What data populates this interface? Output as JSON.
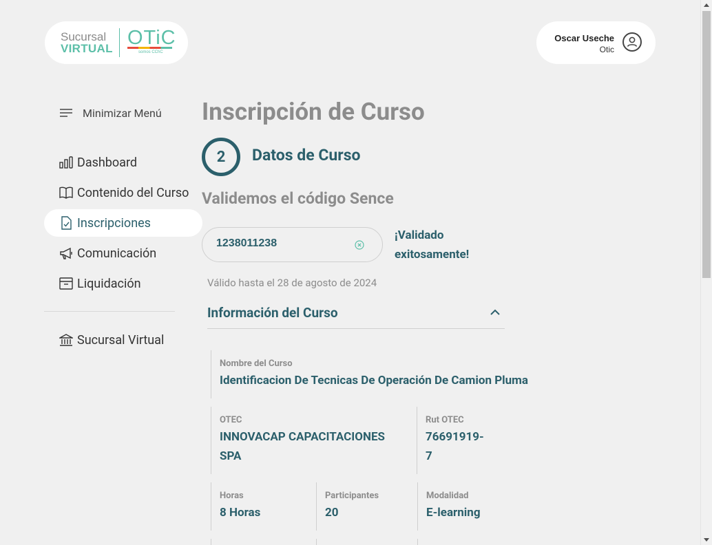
{
  "header": {
    "logo": {
      "line1": "Sucursal",
      "line2": "VIRTUAL",
      "brand": "OTiC",
      "brand_sub": "somos CChC"
    },
    "user": {
      "name": "Oscar Useche",
      "org": "Otic",
      "icon": "user-circle-icon"
    }
  },
  "sidebar": {
    "toggle_label": "Minimizar Menú",
    "items": [
      {
        "label": "Dashboard",
        "icon": "bar-chart-icon"
      },
      {
        "label": "Contenido del Curso",
        "icon": "book-icon"
      },
      {
        "label": "Inscripciones",
        "icon": "document-check-icon",
        "active": true
      },
      {
        "label": "Comunicación",
        "icon": "megaphone-icon"
      },
      {
        "label": "Liquidación",
        "icon": "archive-box-icon"
      }
    ],
    "footer_item": {
      "label": "Sucursal Virtual",
      "icon": "bank-icon"
    }
  },
  "main": {
    "page_title": "Inscripción de Curso",
    "step": {
      "number": "2",
      "title": "Datos de Curso"
    },
    "section_subtitle": "Validemos el código Sence",
    "sence_code": {
      "value": "1238011238"
    },
    "validation_message": "¡Validado exitosamente!",
    "valid_until": "Válido hasta el 28 de agosto de 2024",
    "course_info": {
      "title": "Información del Curso",
      "course_name_label": "Nombre del Curso",
      "course_name": "Identificacion De Tecnicas De Operación De Camion Pluma",
      "otec_label": "OTEC",
      "otec": "INNOVACAP CAPACITACIONES SPA",
      "rut_label": "Rut OTEC",
      "rut": "76691919-7",
      "hours_label": "Horas",
      "hours": "8 Horas",
      "participants_label": "Participantes",
      "participants": "20",
      "modality_label": "Modalidad",
      "modality": "E-learning"
    }
  },
  "colors": {
    "accent": "#2b5f6b",
    "brand_green": "#5cbfa8",
    "muted": "#8c8c8c",
    "background": "#f0f0f0"
  }
}
